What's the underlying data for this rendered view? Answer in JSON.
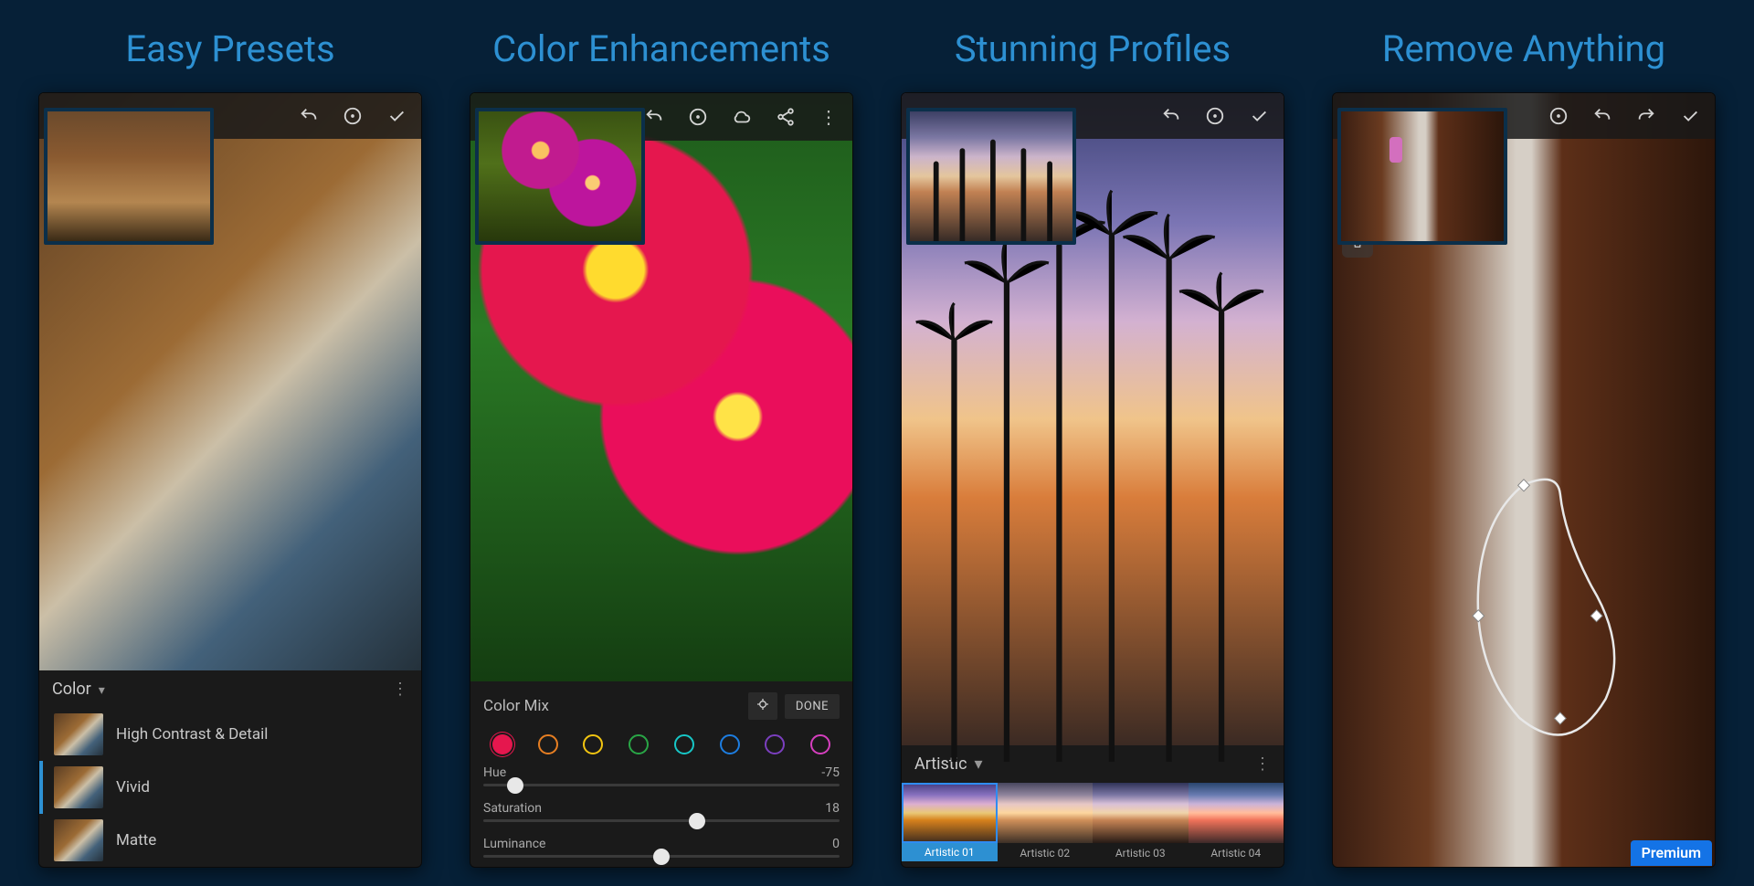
{
  "panels": [
    {
      "title": "Easy Presets"
    },
    {
      "title": "Color Enhancements"
    },
    {
      "title": "Stunning Profiles"
    },
    {
      "title": "Remove Anything"
    }
  ],
  "presets": {
    "section_label": "Color",
    "items": [
      {
        "label": "High Contrast & Detail"
      },
      {
        "label": "Vivid"
      },
      {
        "label": "Matte"
      }
    ],
    "active_index": 1
  },
  "color_mix": {
    "header": "Color Mix",
    "done_label": "DONE",
    "swatches": [
      "#e5174e",
      "#e67e22",
      "#f2c511",
      "#29a646",
      "#17c7c7",
      "#1d7de0",
      "#7b3fbf",
      "#d63fbf"
    ],
    "active_swatch": 0,
    "sliders": [
      {
        "name": "Hue",
        "value": -75,
        "pos": 0.09
      },
      {
        "name": "Saturation",
        "value": 18,
        "pos": 0.6
      },
      {
        "name": "Luminance",
        "value": 0,
        "pos": 0.5
      }
    ]
  },
  "profiles": {
    "section_label": "Artistic",
    "items": [
      {
        "label": "Artistic 01"
      },
      {
        "label": "Artistic 02"
      },
      {
        "label": "Artistic 03"
      },
      {
        "label": "Artistic 04"
      }
    ],
    "active_index": 0
  },
  "premium_label": "Premium"
}
